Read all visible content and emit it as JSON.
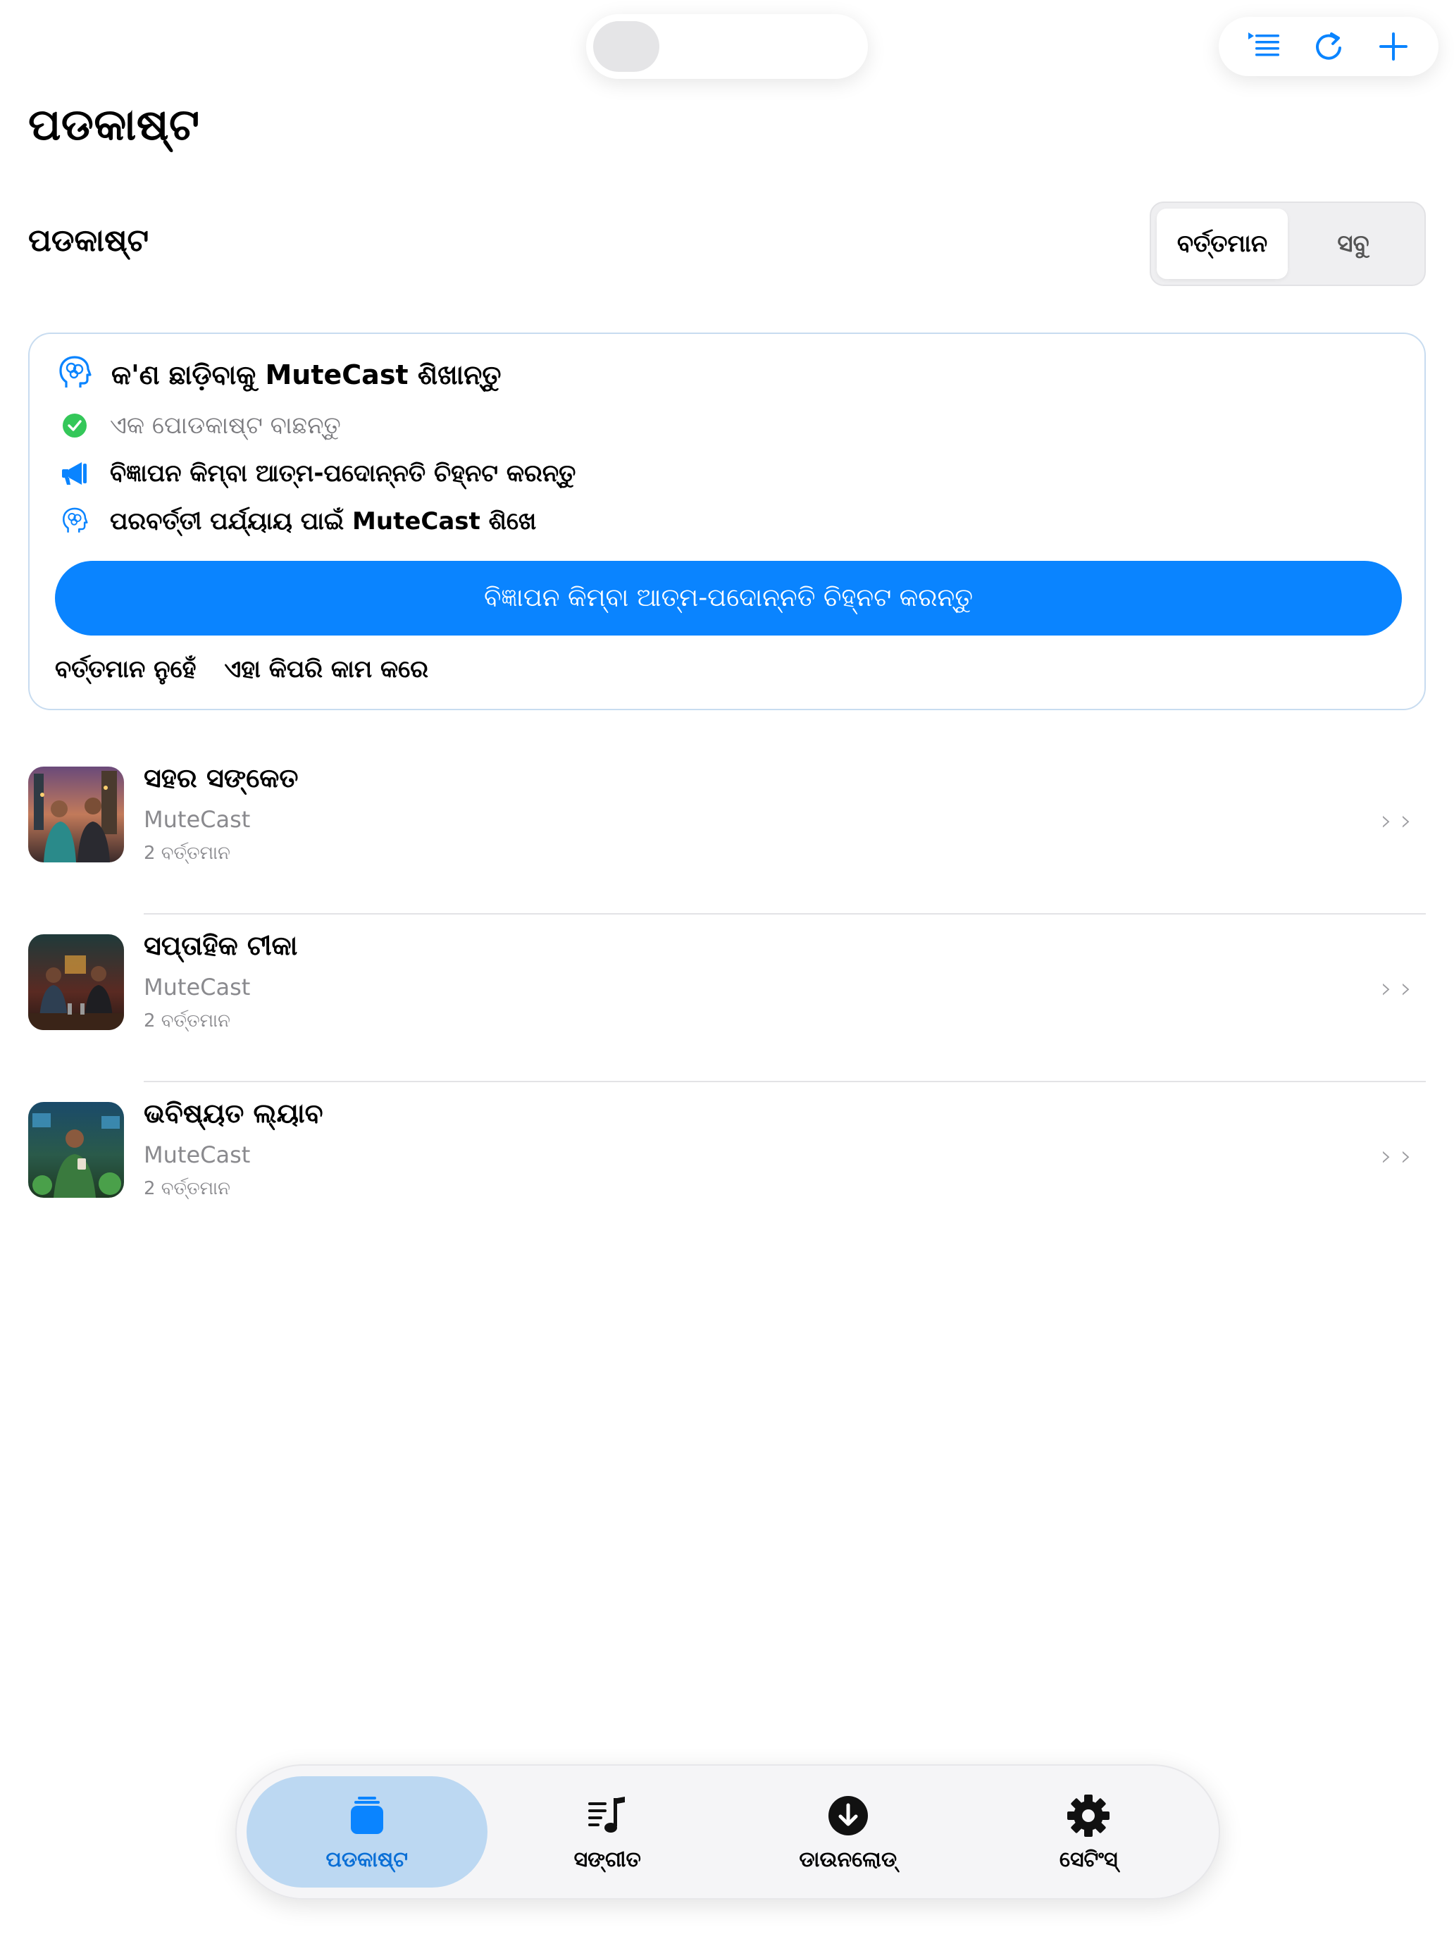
{
  "header": {
    "title": "ପଡକାଷ୍ଟ",
    "icons": [
      "queue-list-icon",
      "refresh-icon",
      "plus-icon"
    ]
  },
  "section": {
    "title": "ପଡକାଷ୍ଟ",
    "segments": [
      "ବର୍ତ୍ତମାନ",
      "ସବୁ"
    ],
    "selected_segment": "ବର୍ତ୍ତମାନ"
  },
  "onboarding": {
    "heading": "କ'ଣ ଛାଡ଼ିବାକୁ MuteCast ଶିଖାନ୍ତୁ",
    "steps": [
      {
        "label": "ଏକ ପୋଡକାଷ୍ଟ ବାଛନ୍ତୁ",
        "done": true
      },
      {
        "label": "ବିଜ୍ଞାପନ କିମ୍ବା ଆତ୍ମ-ପଦୋନ୍ନତି ଚିହ୍ନଟ କରନ୍ତୁ",
        "done": false
      },
      {
        "label": "ପରବର୍ତ୍ତୀ ପର୍ଯ୍ୟାୟ ପାଇଁ MuteCast ଶିଖେ",
        "done": false
      }
    ],
    "cta_label": "ବିଜ୍ଞାପନ କିମ୍ବା ଆତ୍ମ-ପଦୋନ୍ନତି ଚିହ୍ନଟ କରନ୍ତୁ",
    "not_now_label": "ବର୍ତ୍ତମାନ ନୁହେଁ",
    "how_it_works_label": "ଏହା କିପରି କାମ କରେ",
    "accent_color": "#0A84FF"
  },
  "podcasts": [
    {
      "title": "ସହର ସଙ୍କେତ",
      "author": "MuteCast",
      "count": "2 ବର୍ତ୍ତମାନ"
    },
    {
      "title": "ସପ୍ତାହିକ ଟୀକା",
      "author": "MuteCast",
      "count": "2 ବର୍ତ୍ତମାନ"
    },
    {
      "title": "ଭବିଷ୍ୟତ ଲ୍ୟାବ",
      "author": "MuteCast",
      "count": "2 ବର୍ତ୍ତମାନ"
    }
  ],
  "tabbar": {
    "tabs": [
      {
        "label": "ପଡକାଷ୍ଟ",
        "icon": "podcasts-stack-icon",
        "active": true
      },
      {
        "label": "ସଙ୍ଗୀତ",
        "icon": "music-list-icon",
        "active": false
      },
      {
        "label": "ଡାଉନଲୋଡ୍",
        "icon": "download-icon",
        "active": false
      },
      {
        "label": "ସେଟିଂସ୍",
        "icon": "gear-icon",
        "active": false
      }
    ]
  }
}
